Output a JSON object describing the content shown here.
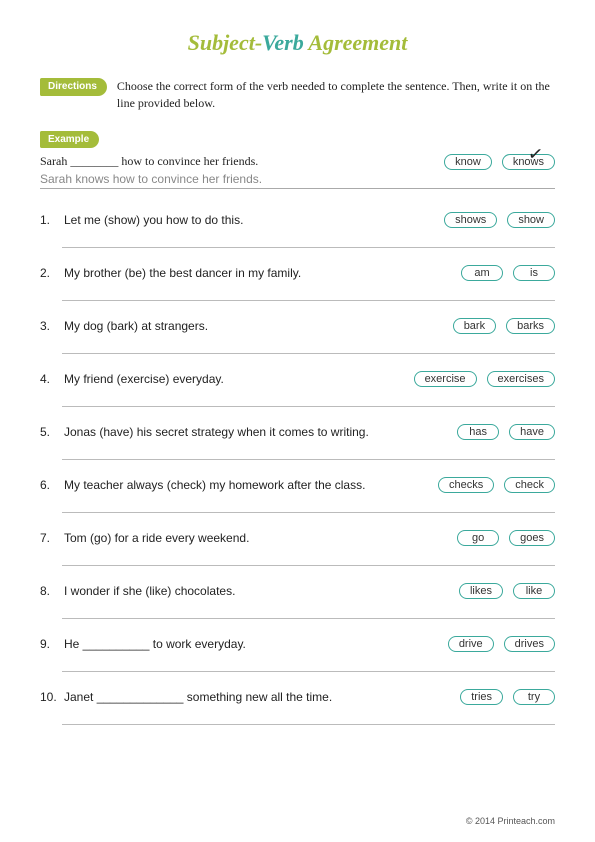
{
  "title": {
    "part1": "Subject-",
    "part2": "Verb",
    "part3": " Agreement"
  },
  "directions_label": "Directions",
  "directions_text": "Choose the correct form of the verb needed to complete the sentence. Then, write it on the line provided below.",
  "example_label": "Example",
  "example": {
    "sentence": "Sarah ________ how to convince her friends.",
    "answer": "Sarah knows how to convince her friends.",
    "choice_a": "know",
    "choice_b": "knows"
  },
  "questions": [
    {
      "num": "1.",
      "text": "Let me (show) you how to do this.",
      "a": "shows",
      "b": "show"
    },
    {
      "num": "2.",
      "text": "My brother (be) the best dancer in my family.",
      "a": "am",
      "b": "is"
    },
    {
      "num": "3.",
      "text": "My dog (bark) at strangers.",
      "a": "bark",
      "b": "barks"
    },
    {
      "num": "4.",
      "text": "My friend (exercise) everyday.",
      "a": "exercise",
      "b": "exercises"
    },
    {
      "num": "5.",
      "text": "Jonas (have) his secret strategy when it comes to writing.",
      "a": "has",
      "b": "have"
    },
    {
      "num": "6.",
      "text": "My teacher always (check) my homework after the class.",
      "a": "checks",
      "b": "check"
    },
    {
      "num": "7.",
      "text": "Tom (go) for a ride every weekend.",
      "a": "go",
      "b": "goes"
    },
    {
      "num": "8.",
      "text": "I wonder if she (like) chocolates.",
      "a": "likes",
      "b": "like"
    },
    {
      "num": "9.",
      "text": "He __________ to work everyday.",
      "a": "drive",
      "b": "drives"
    },
    {
      "num": "10.",
      "text": "Janet _____________ something new all the time.",
      "a": "tries",
      "b": "try"
    }
  ],
  "footer": "© 2014 Printeach.com"
}
